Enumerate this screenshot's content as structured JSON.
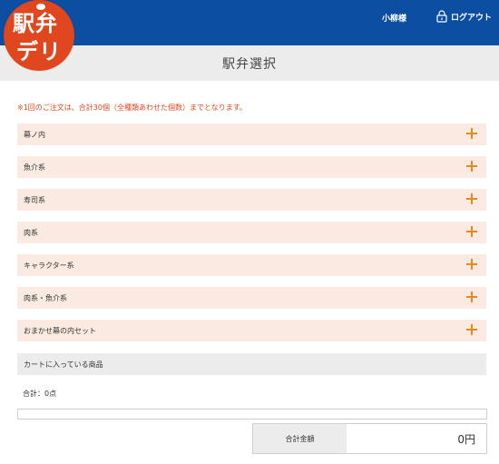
{
  "header": {
    "logo_line1": "駅弁",
    "logo_line2": "デリ",
    "user_name": "小柳様",
    "logout_label": "ログアウト"
  },
  "page": {
    "title": "駅弁選択"
  },
  "notice": "※1回のご注文は、合計30個（全種類あわせた個数）までとなります。",
  "categories": [
    {
      "label": "幕ノ内"
    },
    {
      "label": "魚介系"
    },
    {
      "label": "寿司系"
    },
    {
      "label": "肉系"
    },
    {
      "label": "キャラクター系"
    },
    {
      "label": "肉系・魚介系"
    },
    {
      "label": "おまかせ幕の内セット"
    }
  ],
  "cart": {
    "header": "カートに入っている商品",
    "total_count": "合計：0点",
    "total_label": "合計金額",
    "total_value": "0円"
  },
  "colors": {
    "header_blue": "#0b4ea2",
    "logo_red": "#e0471e",
    "category_bg": "#fbeae2",
    "plus_orange": "#e8891f"
  }
}
